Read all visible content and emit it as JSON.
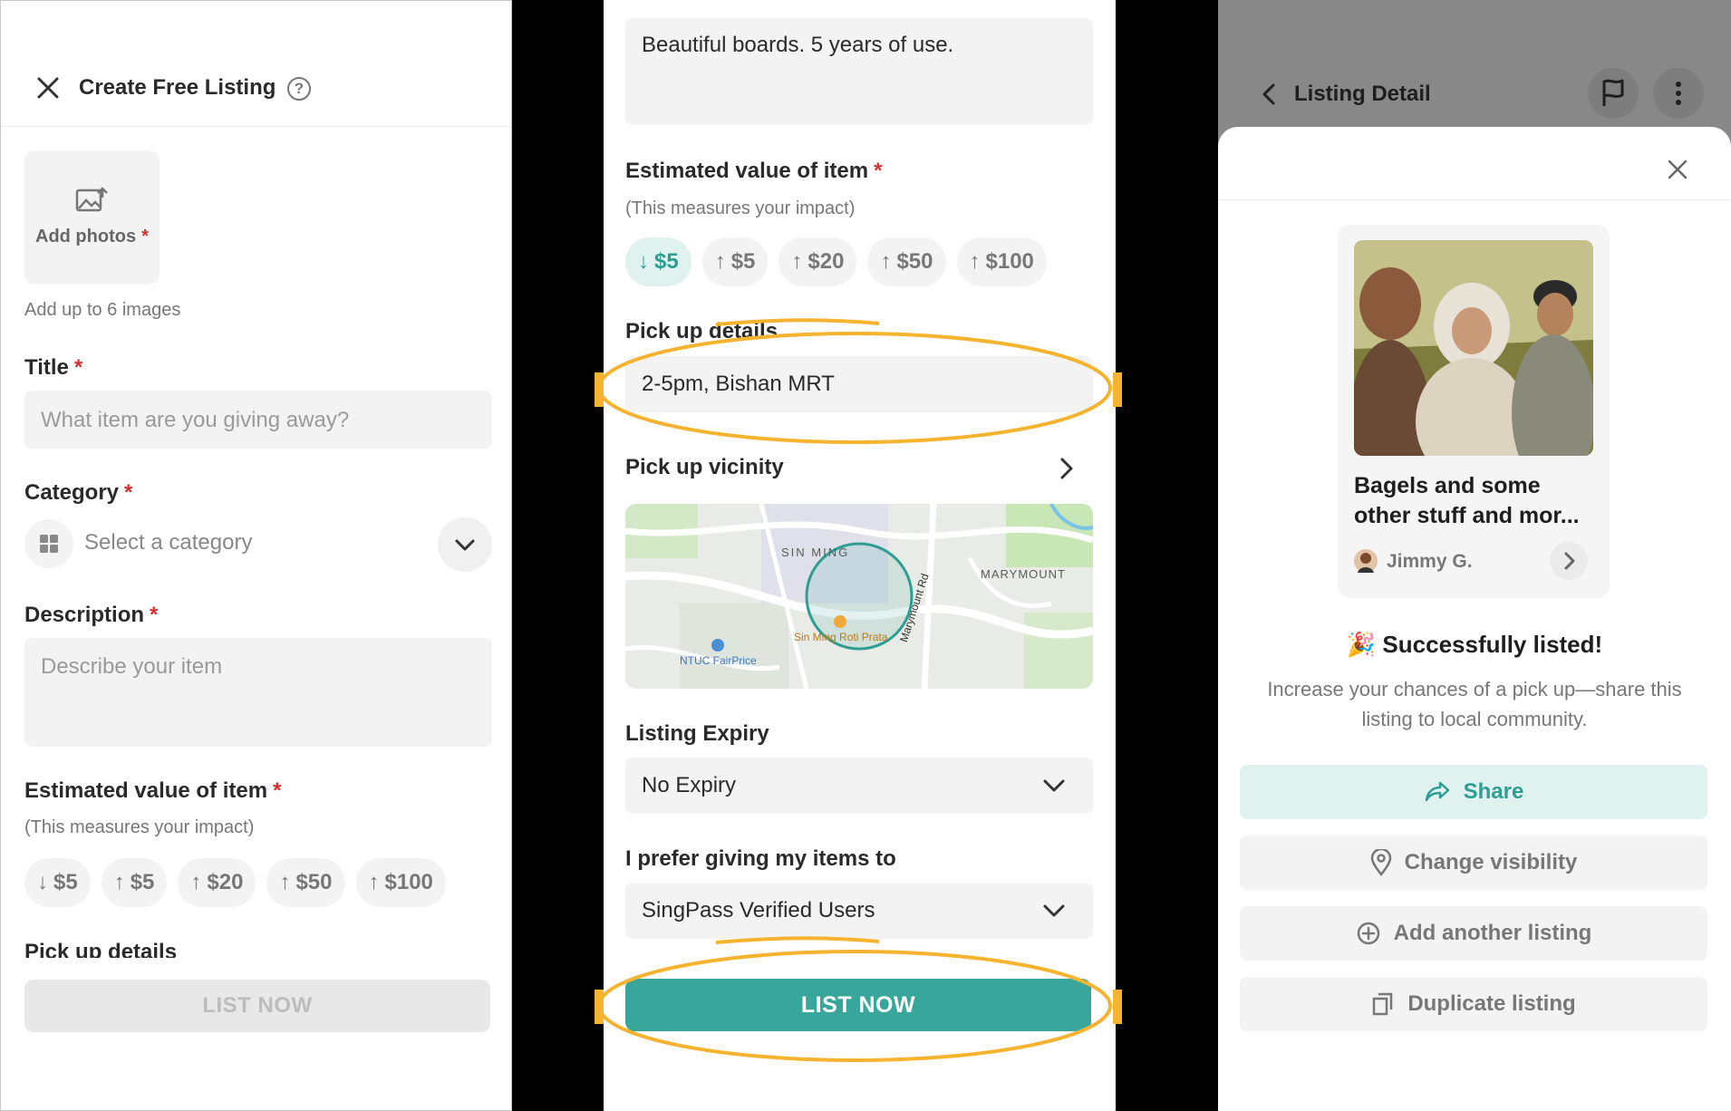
{
  "screen1": {
    "header_title": "Create Free Listing",
    "help_glyph": "?",
    "add_photos_label": "Add photos",
    "required_mark": "*",
    "photos_hint": "Add up to 6 images",
    "title_label": "Title",
    "title_placeholder": "What item are you giving away?",
    "category_label": "Category",
    "category_placeholder": "Select a category",
    "description_label": "Description",
    "description_placeholder": "Describe your item",
    "value_label": "Estimated value of item",
    "value_hint": "(This measures your impact)",
    "value_chips": [
      {
        "arrow": "↓",
        "label": "$5"
      },
      {
        "arrow": "↑",
        "label": "$5"
      },
      {
        "arrow": "↑",
        "label": "$20"
      },
      {
        "arrow": "↑",
        "label": "$50"
      },
      {
        "arrow": "↑",
        "label": "$100"
      }
    ],
    "pickup_label_cut": "Pick up details",
    "list_now_label": "LIST NOW"
  },
  "screen2": {
    "description_value": "Beautiful boards. 5 years of use.",
    "value_label": "Estimated value of item",
    "value_hint": "(This measures your impact)",
    "value_chips": [
      {
        "arrow": "↓",
        "label": "$5",
        "selected": true
      },
      {
        "arrow": "↑",
        "label": "$5"
      },
      {
        "arrow": "↑",
        "label": "$20"
      },
      {
        "arrow": "↑",
        "label": "$50"
      },
      {
        "arrow": "↑",
        "label": "$100"
      }
    ],
    "pickup_details_label": "Pick up details",
    "pickup_details_value": "2-5pm, Bishan MRT",
    "pickup_vicinity_label": "Pick up vicinity",
    "map_labels": {
      "area1": "SIN MING",
      "area2": "MARYMOUNT",
      "poi1": "Sin Ming Roti Prata",
      "poi2": "NTUC FairPrice",
      "road": "Marymount Rd"
    },
    "expiry_label": "Listing Expiry",
    "expiry_value": "No Expiry",
    "preference_label": "I prefer giving my items to",
    "preference_value": "SingPass Verified Users",
    "list_now_label": "LIST NOW",
    "accent_color": "#38a69a",
    "highlight_color": "#f5b330"
  },
  "screen3": {
    "header_title": "Listing Detail",
    "card_title": "Bagels and some other stuff and mor...",
    "owner_name": "Jimmy G.",
    "success_emoji": "🎉",
    "success_title": "Successfully listed!",
    "success_body": "Increase your chances of a pick up—share this listing to local community.",
    "actions": {
      "share": "Share",
      "visibility": "Change visibility",
      "add_another": "Add another listing",
      "duplicate": "Duplicate listing"
    }
  }
}
